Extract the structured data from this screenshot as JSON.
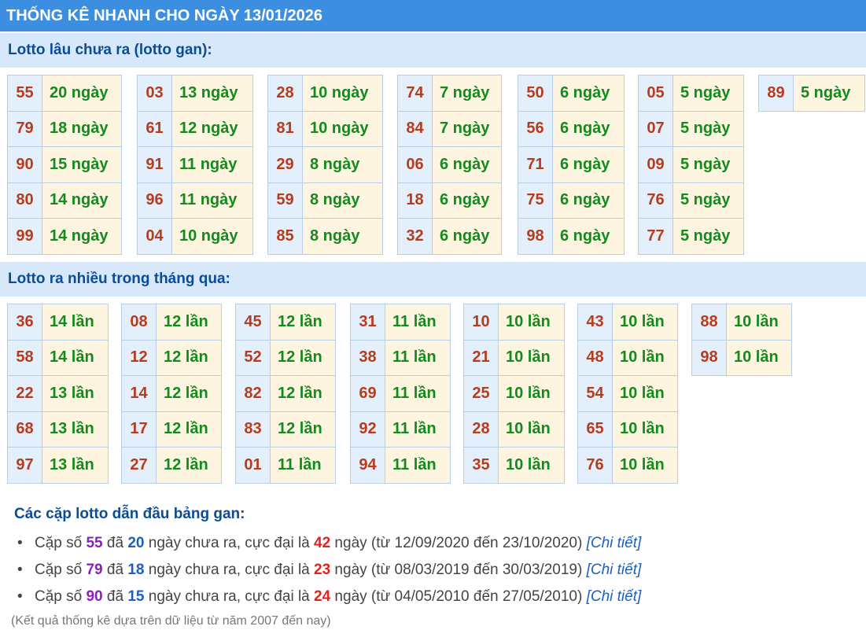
{
  "header": {
    "title": "THỐNG KÊ NHANH CHO NGÀY 13/01/2026"
  },
  "gan": {
    "title": "Lotto lâu chưa ra (lotto gan):",
    "groups": [
      [
        [
          "55",
          "20 ngày"
        ],
        [
          "79",
          "18 ngày"
        ],
        [
          "90",
          "15 ngày"
        ],
        [
          "80",
          "14 ngày"
        ],
        [
          "99",
          "14 ngày"
        ]
      ],
      [
        [
          "03",
          "13 ngày"
        ],
        [
          "61",
          "12 ngày"
        ],
        [
          "91",
          "11 ngày"
        ],
        [
          "96",
          "11 ngày"
        ],
        [
          "04",
          "10 ngày"
        ]
      ],
      [
        [
          "28",
          "10 ngày"
        ],
        [
          "81",
          "10 ngày"
        ],
        [
          "29",
          "8 ngày"
        ],
        [
          "59",
          "8 ngày"
        ],
        [
          "85",
          "8 ngày"
        ]
      ],
      [
        [
          "74",
          "7 ngày"
        ],
        [
          "84",
          "7 ngày"
        ],
        [
          "06",
          "6 ngày"
        ],
        [
          "18",
          "6 ngày"
        ],
        [
          "32",
          "6 ngày"
        ]
      ],
      [
        [
          "50",
          "6 ngày"
        ],
        [
          "56",
          "6 ngày"
        ],
        [
          "71",
          "6 ngày"
        ],
        [
          "75",
          "6 ngày"
        ],
        [
          "98",
          "6 ngày"
        ]
      ],
      [
        [
          "05",
          "5 ngày"
        ],
        [
          "07",
          "5 ngày"
        ],
        [
          "09",
          "5 ngày"
        ],
        [
          "76",
          "5 ngày"
        ],
        [
          "77",
          "5 ngày"
        ]
      ],
      [
        [
          "89",
          "5 ngày"
        ]
      ]
    ]
  },
  "frequent": {
    "title": "Lotto ra nhiều trong tháng qua:",
    "groups": [
      [
        [
          "36",
          "14 lần"
        ],
        [
          "58",
          "14 lần"
        ],
        [
          "22",
          "13 lần"
        ],
        [
          "68",
          "13 lần"
        ],
        [
          "97",
          "13 lần"
        ]
      ],
      [
        [
          "08",
          "12 lần"
        ],
        [
          "12",
          "12 lần"
        ],
        [
          "14",
          "12 lần"
        ],
        [
          "17",
          "12 lần"
        ],
        [
          "27",
          "12 lần"
        ]
      ],
      [
        [
          "45",
          "12 lần"
        ],
        [
          "52",
          "12 lần"
        ],
        [
          "82",
          "12 lần"
        ],
        [
          "83",
          "12 lần"
        ],
        [
          "01",
          "11 lần"
        ]
      ],
      [
        [
          "31",
          "11 lần"
        ],
        [
          "38",
          "11 lần"
        ],
        [
          "69",
          "11 lần"
        ],
        [
          "92",
          "11 lần"
        ],
        [
          "94",
          "11 lần"
        ]
      ],
      [
        [
          "10",
          "10 lần"
        ],
        [
          "21",
          "10 lần"
        ],
        [
          "25",
          "10 lần"
        ],
        [
          "28",
          "10 lần"
        ],
        [
          "35",
          "10 lần"
        ]
      ],
      [
        [
          "43",
          "10 lần"
        ],
        [
          "48",
          "10 lần"
        ],
        [
          "54",
          "10 lần"
        ],
        [
          "65",
          "10 lần"
        ],
        [
          "76",
          "10 lần"
        ]
      ],
      [
        [
          "88",
          "10 lần"
        ],
        [
          "98",
          "10 lần"
        ]
      ]
    ]
  },
  "pairs": {
    "title": "Các cặp lotto dẫn đầu bảng gan:",
    "items": [
      {
        "prefix": "Cặp số ",
        "num": "55",
        "t1": " đã ",
        "days": "20",
        "t2": " ngày chưa ra, cực đại là ",
        "max": "42",
        "t3": " ngày (từ 12/09/2020 đến 23/10/2020) ",
        "link": "[Chi tiết]"
      },
      {
        "prefix": "Cặp số ",
        "num": "79",
        "t1": " đã ",
        "days": "18",
        "t2": " ngày chưa ra, cực đại là ",
        "max": "23",
        "t3": " ngày (từ 08/03/2019 đến 30/03/2019) ",
        "link": "[Chi tiết]"
      },
      {
        "prefix": "Cặp số ",
        "num": "90",
        "t1": " đã ",
        "days": "15",
        "t2": " ngày chưa ra, cực đại là ",
        "max": "24",
        "t3": " ngày (từ 04/05/2010 đến 27/05/2010) ",
        "link": "[Chi tiết]"
      }
    ]
  },
  "footnote": "(Kết quả thống kê dựa trên dữ liệu từ năm 2007 đến nay)",
  "colors": {
    "header_bg": "#3b8ee0",
    "section_bg": "#d6e8fa",
    "number_text": "#b63c1c",
    "value_text": "#138a1f",
    "pair_number": "#8b1fc2",
    "pair_max": "#e3221c",
    "link": "#1b5fc0"
  }
}
